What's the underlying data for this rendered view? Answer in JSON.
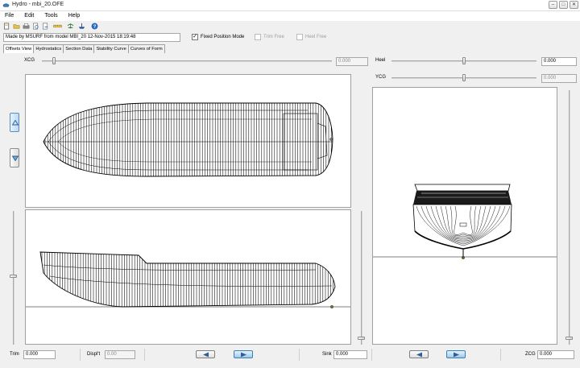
{
  "window": {
    "title": "Hydro - mbi_20.OFE",
    "controls": [
      "–",
      "□",
      "✕"
    ]
  },
  "menu": [
    "File",
    "Edit",
    "Tools",
    "Help"
  ],
  "toolbar_icons": [
    "new-file-icon",
    "open-folder-icon",
    "print-icon",
    "print-preview-icon",
    "export-icon",
    "ruler-icon",
    "hull-balance-icon",
    "ship-icon",
    "help-icon"
  ],
  "info": {
    "description": "Made by MSURF from model MBI_20  12-Nov-2015  18:19:48",
    "fixed_position_label": "Fixed Position Mode",
    "fixed_position_checked": true,
    "trim_free_label": "Trim Free",
    "heel_free_label": "Heel Free"
  },
  "tabs": [
    "Offsets View",
    "Hydrostatics",
    "Section Data",
    "Stability Curve",
    "Curves of Form"
  ],
  "active_tab": 0,
  "sliders": {
    "xcg": {
      "label": "XCG",
      "value": "0.000",
      "position": 0.03
    },
    "heel": {
      "label": "Heel",
      "value": "0.000",
      "position": 0.5
    },
    "ycg": {
      "label": "YCG",
      "value": "0.000",
      "position": 0.5
    },
    "side_vertical": {
      "position": 0.45
    },
    "right_vertical": {
      "position": 0.97
    }
  },
  "status": {
    "trim_label": "Trim",
    "trim_value": "0.000",
    "displ_label": "Displ't",
    "displ_value": "0.00",
    "sink_label": "Sink",
    "sink_value": "0.000",
    "zcg_label": "ZCG",
    "zcg_value": "0.000"
  },
  "colors": {
    "button_blue": "#9ec8ea",
    "hull_line": "#000000"
  }
}
